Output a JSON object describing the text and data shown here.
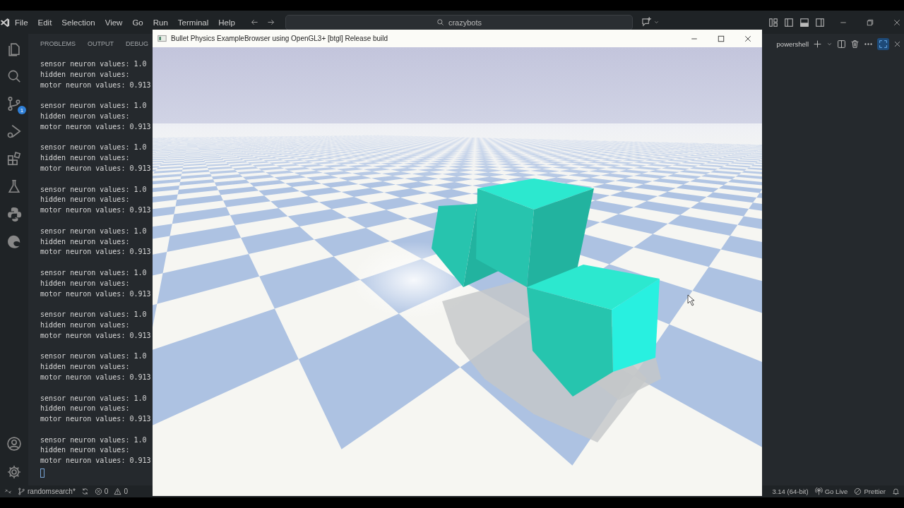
{
  "title_bar": {
    "menu": [
      "File",
      "Edit",
      "Selection",
      "View",
      "Go",
      "Run",
      "Terminal",
      "Help"
    ],
    "search": {
      "value": "crazybots"
    }
  },
  "activity_bar": {
    "source_control_badge": "1"
  },
  "panel": {
    "tabs": [
      "PROBLEMS",
      "OUTPUT",
      "DEBUG"
    ],
    "shell": "powershell"
  },
  "terminal": {
    "blocks": [
      {
        "lines": [
          "sensor neuron values: 1.0",
          "hidden neuron values:",
          "motor neuron values: 0.913"
        ]
      },
      {
        "lines": [
          "sensor neuron values: 1.0",
          "hidden neuron values:",
          "motor neuron values: 0.913"
        ]
      },
      {
        "lines": [
          "sensor neuron values: 1.0",
          "hidden neuron values:",
          "motor neuron values: 0.913"
        ]
      },
      {
        "lines": [
          "sensor neuron values: 1.0",
          "hidden neuron values:",
          "motor neuron values: 0.913"
        ]
      },
      {
        "lines": [
          "sensor neuron values: 1.0",
          "hidden neuron values:",
          "motor neuron values: 0.913"
        ]
      },
      {
        "lines": [
          "sensor neuron values: 1.0",
          "hidden neuron values:",
          "motor neuron values: 0.913"
        ]
      },
      {
        "lines": [
          "sensor neuron values: 1.0",
          "hidden neuron values:",
          "motor neuron values: 0.913"
        ]
      },
      {
        "lines": [
          "sensor neuron values: 1.0",
          "hidden neuron values:",
          "motor neuron values: 0.913"
        ]
      },
      {
        "lines": [
          "sensor neuron values: 1.0",
          "hidden neuron values:",
          "motor neuron values: 0.913"
        ]
      },
      {
        "lines": [
          "sensor neuron values: 1.0",
          "hidden neuron values:",
          "motor neuron values: 0.913"
        ]
      }
    ]
  },
  "app_window": {
    "title": "Bullet Physics ExampleBrowser using OpenGL3+ [btgl] Release build"
  },
  "status_bar": {
    "branch": "randomsearch*",
    "errors": "0",
    "warnings": "0",
    "python_version": "3.14 (64-bit)",
    "go_live": "Go Live",
    "prettier": "Prettier"
  }
}
